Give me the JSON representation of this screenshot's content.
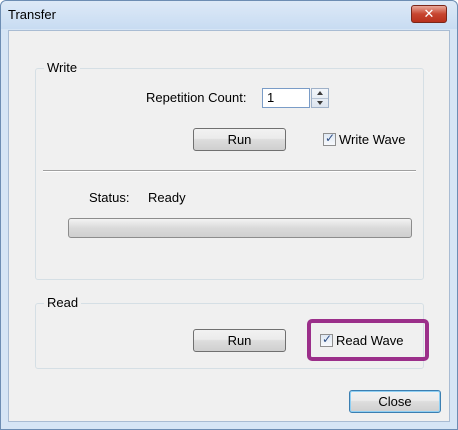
{
  "window": {
    "title": "Transfer",
    "close_glyph": "✕"
  },
  "write_group": {
    "label": "Write",
    "repetition_label": "Repetition Count:",
    "repetition_value": "1",
    "run_label": "Run",
    "write_wave_label": "Write Wave",
    "write_wave_checked": true,
    "status_label": "Status:",
    "status_value": "Ready",
    "progress_fraction": 0
  },
  "read_group": {
    "label": "Read",
    "run_label": "Run",
    "read_wave_label": "Read Wave",
    "read_wave_checked": true
  },
  "footer": {
    "close_label": "Close"
  },
  "colors": {
    "highlight": "#9b2f8a",
    "title_bar": "#d6e5f5",
    "close_button": "#c7452f"
  }
}
